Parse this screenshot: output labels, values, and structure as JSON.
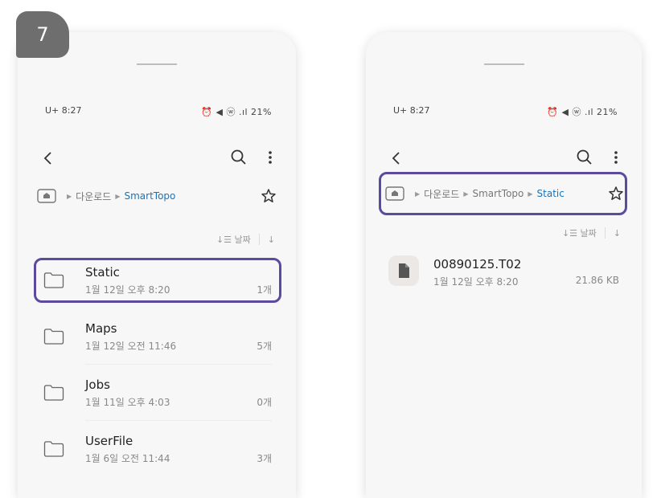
{
  "step_number": "7",
  "left_screen": {
    "status_time": "8:27",
    "status_carrier": "U+",
    "status_icons": "⏰ ◀ ⓦ .ıl 21%",
    "breadcrumb": [
      "다운로드",
      "SmartTopo"
    ],
    "sort_label": "날짜",
    "folders": [
      {
        "name": "Static",
        "date": "1월 12일 오후 8:20",
        "count": "1개",
        "highlighted": true
      },
      {
        "name": "Maps",
        "date": "1월 12일 오전 11:46",
        "count": "5개",
        "highlighted": false
      },
      {
        "name": "Jobs",
        "date": "1월 11일 오후 4:03",
        "count": "0개",
        "highlighted": false
      },
      {
        "name": "UserFile",
        "date": "1월 6일 오전 11:44",
        "count": "3개",
        "highlighted": false
      }
    ]
  },
  "right_screen": {
    "status_time": "8:27",
    "status_carrier": "U+",
    "status_icons": "⏰ ◀ ⓦ .ıl 21%",
    "breadcrumb": [
      "다운로드",
      "SmartTopo",
      "Static"
    ],
    "sort_label": "날짜",
    "files": [
      {
        "name": "00890125.T02",
        "date": "1월 12일 오후 8:20",
        "size": "21.86 KB"
      }
    ]
  },
  "colors": {
    "highlight": "#5b4a9e",
    "current_crumb": "#1a73b8",
    "badge": "#6e6e6e"
  }
}
